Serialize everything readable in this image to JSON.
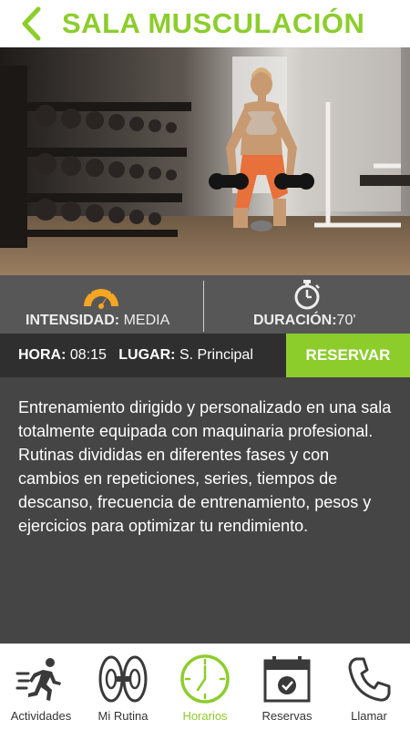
{
  "header": {
    "title": "SALA MUSCULACIÓN"
  },
  "hero": {
    "alt": "woman lifting dumbbells in gym"
  },
  "stats": {
    "intensity_label": "INTENSIDAD:",
    "intensity_value": "MEDIA",
    "duration_label": "DURACIÓN:",
    "duration_value": "70'"
  },
  "booking": {
    "time_label": "HORA:",
    "time_value": "08:15",
    "place_label": "LUGAR:",
    "place_value": "S. Principal",
    "reserve_label": "RESERVAR"
  },
  "description": "Entrenamiento dirigido y personalizado en una sala totalmente equipada con maquinaria profesional. Rutinas divididas en diferentes fases y con cambios en repeticiones, series, tiempos de descanso, frecuencia de entrenamiento, pesos y ejercicios para optimizar tu rendimiento.",
  "tabs": [
    {
      "label": "Actividades",
      "icon": "running-person-icon"
    },
    {
      "label": "Mi Rutina",
      "icon": "weight-plates-icon"
    },
    {
      "label": "Horarios",
      "icon": "clock-icon",
      "active": true
    },
    {
      "label": "Reservas",
      "icon": "calendar-check-icon"
    },
    {
      "label": "Llamar",
      "icon": "phone-icon"
    }
  ],
  "colors": {
    "accent": "#8ccd2c",
    "gauge": "#f5a623",
    "dark": "#2f2f2f",
    "panel": "#454545",
    "stats_bg": "#575757"
  }
}
